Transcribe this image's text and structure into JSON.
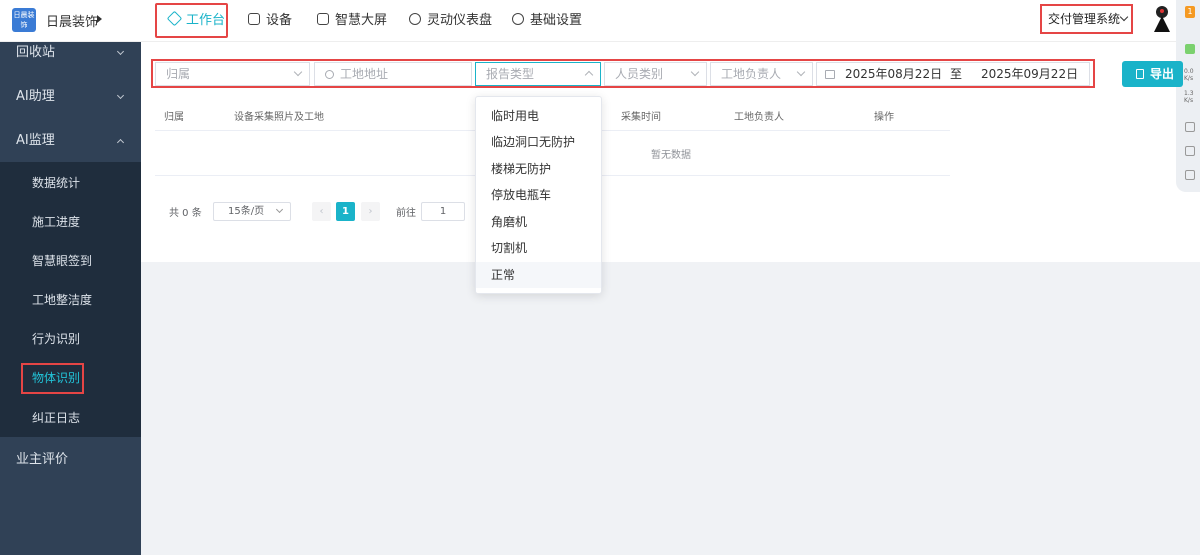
{
  "header": {
    "logo_text": "日晨装饰",
    "brand": "日晨装饰",
    "nav": [
      {
        "label": "工作台"
      },
      {
        "label": "设备"
      },
      {
        "label": "智慧大屏"
      },
      {
        "label": "灵动仪表盘"
      },
      {
        "label": "基础设置"
      }
    ],
    "system_select": "交付管理系统"
  },
  "side_widget": {
    "badge": "1",
    "stat_down": "0.0 K/s",
    "stat_up": "1.3 K/s"
  },
  "sidebar": {
    "items": [
      {
        "label": "回收站"
      },
      {
        "label": "AI助理"
      },
      {
        "label": "AI监理"
      },
      {
        "label": "业主评价"
      }
    ],
    "sub_items": [
      {
        "label": "数据统计"
      },
      {
        "label": "施工进度"
      },
      {
        "label": "智慧眼签到"
      },
      {
        "label": "工地整洁度"
      },
      {
        "label": "行为识别"
      },
      {
        "label": "物体识别"
      },
      {
        "label": "纠正日志"
      }
    ]
  },
  "filters": {
    "belong": "归属",
    "site_address": "工地地址",
    "report_type": "报告类型",
    "person_type": "人员类别",
    "site_manager": "工地负责人",
    "date_start": "2025年08月22日",
    "date_sep": "至",
    "date_end": "2025年09月22日",
    "export": "导出"
  },
  "report_type_options": [
    "临时用电",
    "临边洞口无防护",
    "楼梯无防护",
    "停放电瓶车",
    "角磨机",
    "切割机",
    "正常"
  ],
  "table": {
    "columns": [
      "归属",
      "设备采集照片及工地",
      "采集时间",
      "工地负责人",
      "操作"
    ],
    "empty_text": "暂无数据"
  },
  "pagination": {
    "total": "共 0 条",
    "page_size": "15条/页",
    "prev": "‹",
    "current": "1",
    "next": "›",
    "goto_label": "前往",
    "goto_value": "1"
  }
}
